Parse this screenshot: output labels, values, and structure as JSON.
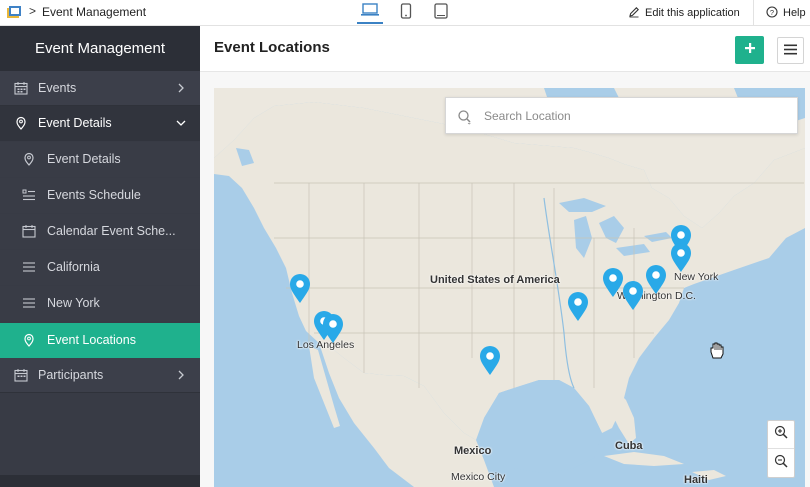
{
  "topbar": {
    "app_name": "Event Management",
    "breadcrumb_separator": ">",
    "edit_label": "Edit this application",
    "help_label": "Help",
    "icons": [
      "app-logo-icon",
      "laptop-icon",
      "phone-icon",
      "tablet-icon",
      "pencil-icon",
      "help-circle-icon"
    ]
  },
  "sidebar": {
    "title": "Event Management",
    "items": [
      {
        "label": "Events",
        "icon": "calendar-icon",
        "level": "top",
        "expandable": true
      },
      {
        "label": "Event Details",
        "icon": "location-icon",
        "level": "top",
        "expanded": true
      },
      {
        "label": "Event Details",
        "icon": "location-icon",
        "level": "sub"
      },
      {
        "label": "Events Schedule",
        "icon": "list-icon",
        "level": "sub"
      },
      {
        "label": "Calendar Event Sche...",
        "icon": "calendar-icon",
        "level": "sub"
      },
      {
        "label": "California",
        "icon": "list-icon",
        "level": "sub"
      },
      {
        "label": "New York",
        "icon": "list-icon",
        "level": "sub"
      },
      {
        "label": "Event Locations",
        "icon": "location-icon",
        "level": "sub",
        "active": true
      },
      {
        "label": "Participants",
        "icon": "calendar-icon",
        "level": "top",
        "expandable": true
      }
    ]
  },
  "page": {
    "title": "Event Locations",
    "add_icon": "plus-icon",
    "menu_icon": "hamburger-icon"
  },
  "map": {
    "search_placeholder": "Search Location",
    "labels": {
      "country_us": "United States of America",
      "new_york": "New York",
      "washington": "Washington D.C.",
      "los_angeles": "Los Angeles",
      "mexico": "Mexico",
      "cuba": "Cuba",
      "mexico_city": "Mexico City",
      "haiti": "Haiti"
    },
    "pin_count": 11,
    "colors": {
      "water": "#a9cde8",
      "land": "#ebe7dd",
      "pin": "#29a9e8",
      "accent": "#1fb18d"
    }
  }
}
